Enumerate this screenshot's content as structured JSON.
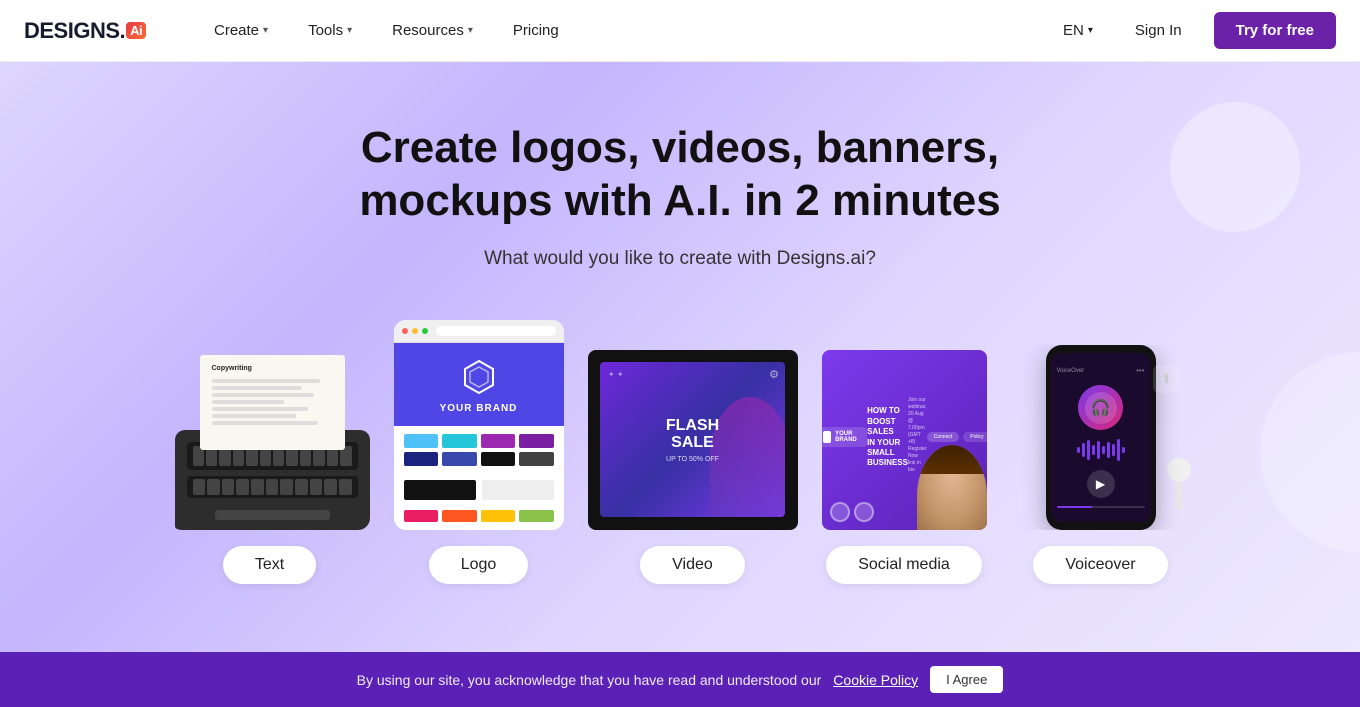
{
  "brand": {
    "name_designs": "DESIGNS.",
    "name_ai": "Ai",
    "logo_icon": "✦"
  },
  "navbar": {
    "create_label": "Create",
    "tools_label": "Tools",
    "resources_label": "Resources",
    "pricing_label": "Pricing",
    "lang_label": "EN",
    "sign_in_label": "Sign In",
    "try_free_label": "Try for free"
  },
  "hero": {
    "title": "Create logos, videos, banners, mockups with A.I. in 2 minutes",
    "subtitle": "What would you like to create with Designs.ai?"
  },
  "cards": [
    {
      "id": "text",
      "label": "Text"
    },
    {
      "id": "logo",
      "label": "Logo"
    },
    {
      "id": "video",
      "label": "Video"
    },
    {
      "id": "social",
      "label": "Social media"
    },
    {
      "id": "voiceover",
      "label": "Voiceover"
    }
  ],
  "cookie": {
    "text": "By using our site, you acknowledge that you have read and understood our",
    "link_text": "Cookie Policy",
    "agree_label": "I Agree"
  },
  "colors": {
    "logo_swatches": [
      "#4fc3f7",
      "#26c6da",
      "#9c27b0",
      "#7b1fa2",
      "#1a237e",
      "#3949ab",
      "#111111",
      "#424242"
    ]
  }
}
